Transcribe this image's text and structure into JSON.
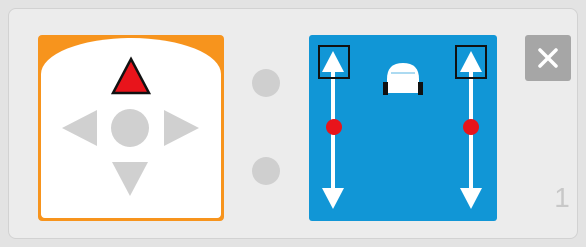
{
  "block": {
    "index_label": "1",
    "dpad": {
      "accent_color": "#f7941d",
      "active_direction": "up",
      "active_color": "#e8141b",
      "inactive_color": "#d0d0d0",
      "icons": [
        "triangle-up-icon",
        "triangle-left-icon",
        "circle-center-icon",
        "triangle-right-icon",
        "triangle-down-icon"
      ]
    },
    "indicators": {
      "color": "#cfcfcf",
      "count": 2
    },
    "tank_drive": {
      "background_color": "#1196d6",
      "left_slider_color": "#e8141b",
      "right_slider_color": "#e8141b",
      "icons": [
        "double-arrow-left-icon",
        "robot-icon",
        "double-arrow-right-icon"
      ]
    },
    "close": {
      "icon": "close-icon",
      "color": "#a6a6a6"
    }
  }
}
